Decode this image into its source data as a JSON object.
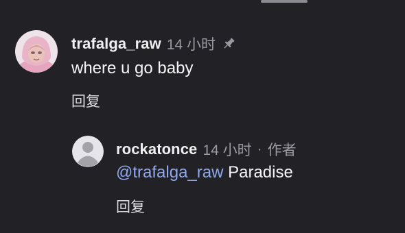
{
  "comment": {
    "username": "trafalga_raw",
    "time": "14 小时",
    "text": "where u go baby",
    "reply_label": "回复",
    "pinned_icon": "pin-icon"
  },
  "reply": {
    "username": "rockatonce",
    "time": "14 小时",
    "separator": "·",
    "author_tag": "作者",
    "mention": "@trafalga_raw",
    "text": " Paradise",
    "reply_label": "回复",
    "avatar_icon": "default-user-avatar"
  },
  "colors": {
    "background": "#222226",
    "mention": "#8fa8f0",
    "muted": "#9b9ba1"
  }
}
